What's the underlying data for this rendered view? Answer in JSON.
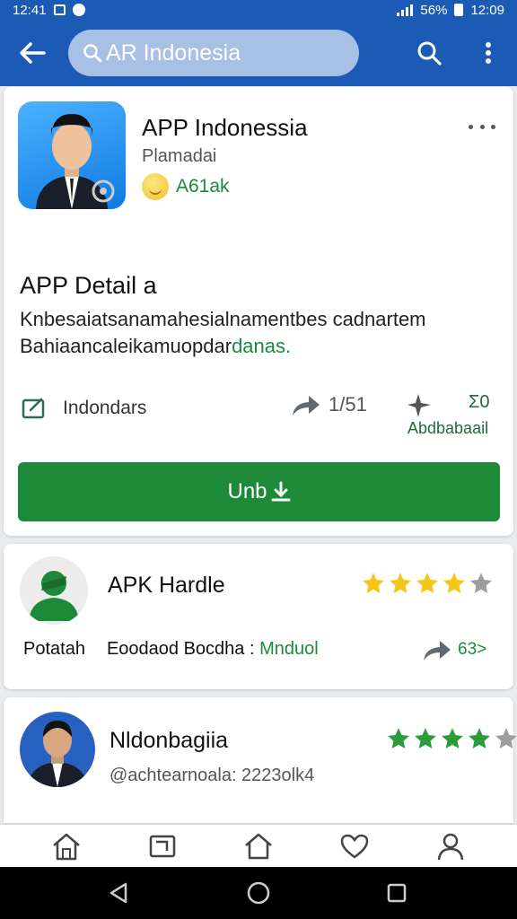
{
  "status_bar": {
    "time_left": "12:41",
    "battery": "56%",
    "time_right": "12:09"
  },
  "app_bar": {
    "search_text": "AR Indonesia"
  },
  "app_card": {
    "title": "APP Indonessia",
    "developer": "Plamadai",
    "rating_text": "A61ak",
    "detail_title": "APP Detail a",
    "detail_line1": "Knbesaiatsanamahesialnamentbes cadnartem",
    "detail_line2_a": "Bahiaancaleikamuopdar",
    "detail_line2_b": "danas.",
    "category": "Indondars",
    "share_count": "1/51",
    "cc_label": "Σ0",
    "downloads_label": "Abdbabaail",
    "install_label": "Unb"
  },
  "card2": {
    "title": "APK Hardle",
    "rating": 4,
    "line_a": "Potatah",
    "line_b": "Eoodaod Bocdha :",
    "line_c": "Mnduol",
    "share_value": "63>"
  },
  "card3": {
    "title": "Nldonbagiia",
    "rating": 4,
    "subtitle": "@achtearnoala: 2223olk4"
  },
  "icons": {
    "back": "arrow-left-icon",
    "search": "search-icon",
    "more": "more-vertical-icon",
    "share": "share-icon",
    "home": "home-icon",
    "library": "library-icon",
    "favorite": "heart-icon",
    "account": "person-icon"
  },
  "colors": {
    "primary": "#1c5bb5",
    "accent": "#1d8a3a",
    "star": "#f5c518",
    "star_green": "#2a9d3a"
  }
}
